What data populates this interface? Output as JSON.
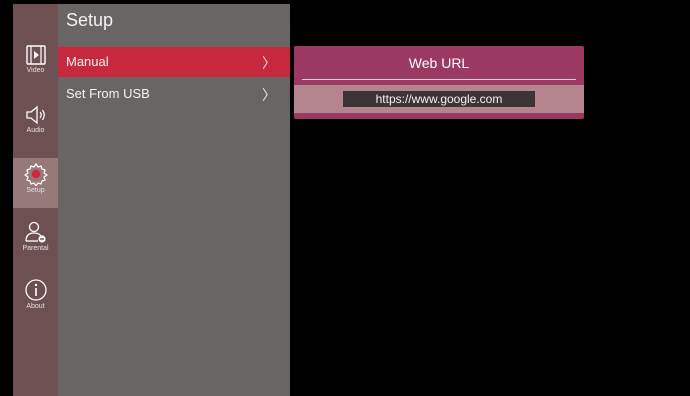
{
  "sidebar": {
    "items": [
      {
        "label": "Video",
        "icon": "video-icon"
      },
      {
        "label": "Audio",
        "icon": "speaker-icon"
      },
      {
        "label": "Setup",
        "icon": "gear-icon",
        "active": true
      },
      {
        "label": "Parental",
        "icon": "parental-user-icon"
      },
      {
        "label": "About",
        "icon": "info-icon"
      }
    ]
  },
  "menu": {
    "title": "Setup",
    "items": [
      {
        "label": "Manual",
        "chevron": "〉",
        "selected": true
      },
      {
        "label": "Set From USB",
        "chevron": "〉",
        "selected": false
      }
    ]
  },
  "dialog": {
    "title": "Web URL",
    "url_value": "https://www.google.com"
  },
  "colors": {
    "rail": "#6e4f52",
    "menu": "#6a6565",
    "selected": "#c8283e",
    "dialog": "#9a3a62"
  }
}
